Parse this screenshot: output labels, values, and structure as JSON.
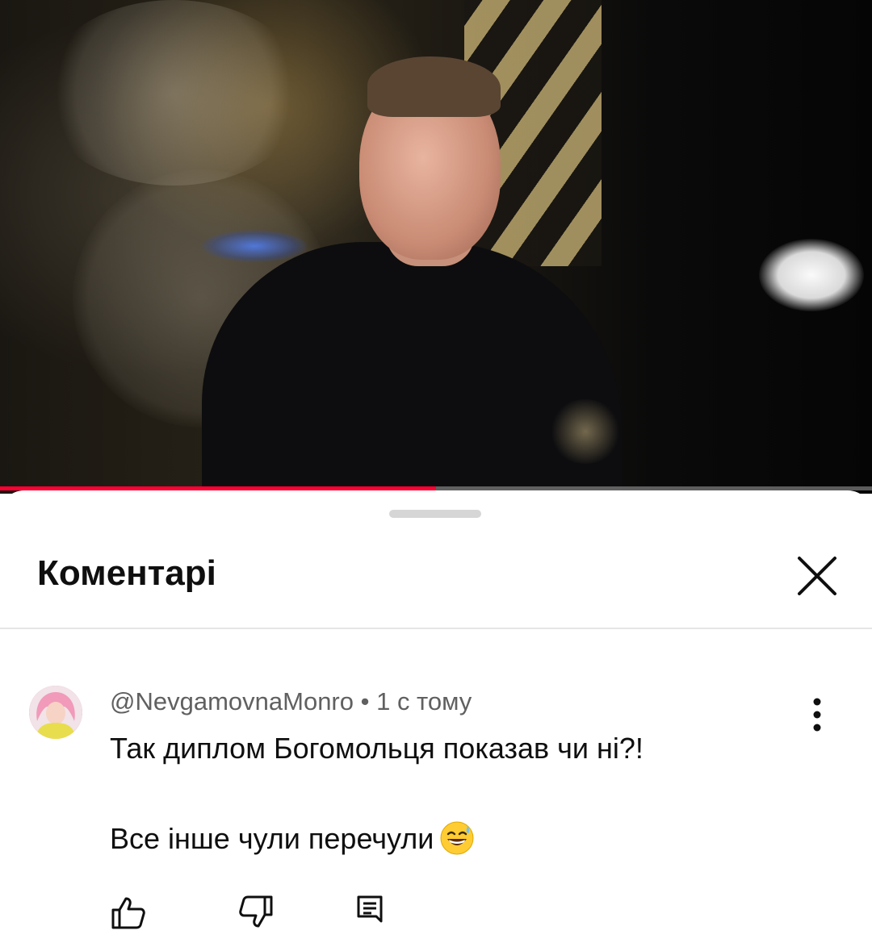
{
  "video": {
    "progress_fraction": 0.5
  },
  "comments_sheet": {
    "title": "Коментарі",
    "close_icon": "close-icon"
  },
  "comment": {
    "author": "@NevgamovnaMonro",
    "separator": " • ",
    "time": "1 с тому",
    "text_line1": "Так диплом Богомольця  показав чи ні?!",
    "text_line2": "Все інше чули перечули",
    "emoji": "grinning-face-with-sweat",
    "actions": {
      "like_icon": "thumbs-up-icon",
      "dislike_icon": "thumbs-down-icon",
      "reply_icon": "reply-icon",
      "more_icon": "more-vertical-icon"
    }
  },
  "colors": {
    "progress": "#ff0033",
    "text_primary": "#0f0f0f",
    "text_secondary": "#606060"
  }
}
